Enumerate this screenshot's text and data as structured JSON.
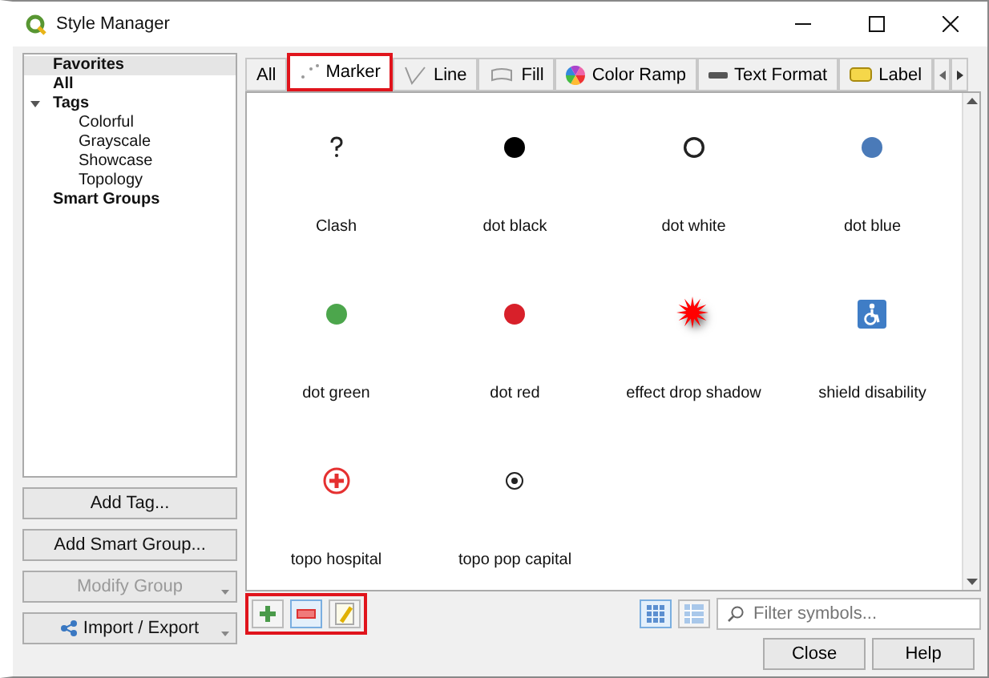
{
  "window": {
    "title": "Style Manager"
  },
  "sidebar": {
    "items": [
      {
        "label": "Favorites",
        "selected": true
      },
      {
        "label": "All",
        "selected": false
      },
      {
        "label": "Tags",
        "selected": false,
        "expanded": true,
        "children": [
          {
            "label": "Colorful",
            "selected": false
          },
          {
            "label": "Grayscale",
            "selected": false
          },
          {
            "label": "Showcase",
            "selected": false
          },
          {
            "label": "Topology",
            "selected": false
          }
        ]
      },
      {
        "label": "Smart Groups",
        "selected": false
      }
    ]
  },
  "side_buttons": [
    {
      "label": "Add Tag...",
      "kind": "plain",
      "disabled": false,
      "dropdown": false
    },
    {
      "label": "Add Smart Group...",
      "kind": "plain",
      "disabled": false,
      "dropdown": false
    },
    {
      "label": "Modify Group",
      "kind": "plain",
      "disabled": true,
      "dropdown": true
    },
    {
      "label": "Import / Export",
      "kind": "share",
      "disabled": false,
      "dropdown": true
    }
  ],
  "tabs": [
    {
      "label": "All",
      "kind": "all",
      "selected": false,
      "highlighted": false
    },
    {
      "label": "Marker",
      "kind": "marker",
      "selected": true,
      "highlighted": true
    },
    {
      "label": "Line",
      "kind": "line",
      "selected": false,
      "highlighted": false
    },
    {
      "label": "Fill",
      "kind": "fill",
      "selected": false,
      "highlighted": false
    },
    {
      "label": "Color Ramp",
      "kind": "ramp",
      "selected": false,
      "highlighted": false
    },
    {
      "label": "Text Format",
      "kind": "text",
      "selected": false,
      "highlighted": false
    },
    {
      "label": "Label",
      "kind": "label",
      "selected": false,
      "highlighted": false
    }
  ],
  "symbols": [
    {
      "name": "Clash",
      "kind": "question",
      "color": "#222222"
    },
    {
      "name": "dot  black",
      "kind": "dot",
      "color": "#000000"
    },
    {
      "name": "dot  white",
      "kind": "ring",
      "color": "#ffffff"
    },
    {
      "name": "dot blue",
      "kind": "dot",
      "color": "#4a7ab8"
    },
    {
      "name": "dot green",
      "kind": "dot",
      "color": "#4ca64c"
    },
    {
      "name": "dot red",
      "kind": "dot",
      "color": "#d8202a"
    },
    {
      "name": "effect drop shadow",
      "kind": "star",
      "color": "#ff0000"
    },
    {
      "name": "shield disability",
      "kind": "shield",
      "color": "#3f7dc6"
    },
    {
      "name": "topo hospital",
      "kind": "hospital",
      "color": "#e53030"
    },
    {
      "name": "topo pop capital",
      "kind": "target",
      "color": "#222222"
    }
  ],
  "symbol_actions": {
    "highlighted": true,
    "buttons": [
      {
        "kind": "add",
        "selected": false
      },
      {
        "kind": "remove",
        "selected": true
      },
      {
        "kind": "edit",
        "selected": false
      }
    ]
  },
  "view_modes": [
    {
      "kind": "icons",
      "selected": true
    },
    {
      "kind": "list",
      "selected": false
    }
  ],
  "filter": {
    "placeholder": "Filter symbols..."
  },
  "buttons": [
    "Close",
    "Help"
  ]
}
